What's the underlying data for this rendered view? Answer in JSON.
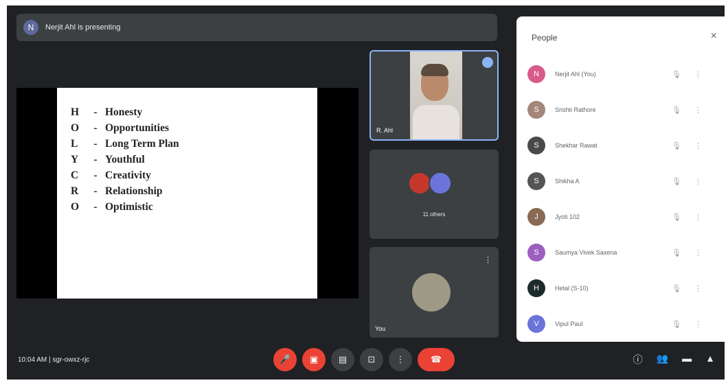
{
  "banner": {
    "presenter_text": "Nerjit Ahl is presenting",
    "avatar_letter": "N"
  },
  "slide": {
    "rows": [
      {
        "letter": "H",
        "dash": "-",
        "word": "Honesty"
      },
      {
        "letter": "O",
        "dash": "-",
        "word": "Opportunities"
      },
      {
        "letter": "L",
        "dash": "-",
        "word": "Long Term Plan"
      },
      {
        "letter": "Y",
        "dash": "-",
        "word": "Youthful"
      },
      {
        "letter": "C",
        "dash": "-",
        "word": "Creativity"
      },
      {
        "letter": "R",
        "dash": "-",
        "word": "Relationship"
      },
      {
        "letter": "O",
        "dash": "-",
        "word": "Optimistic"
      }
    ]
  },
  "tiles": {
    "tile1_name": "R. Ahl",
    "tile2_label": "11 others",
    "tile3_name": "You"
  },
  "bottom": {
    "meeting_info": "10:04 AM  |  sgr-owxz-rjc"
  },
  "people_panel": {
    "title": "People",
    "close": "×",
    "people": [
      {
        "name": "Nerjit Ahl (You)",
        "initial": "N",
        "color": "#d95a8a"
      },
      {
        "name": "Srishti Rathore",
        "initial": "S",
        "color": "#a2877a"
      },
      {
        "name": "Shekhar Rawat",
        "initial": "S",
        "color": "#4a4a4a"
      },
      {
        "name": "Shikha A",
        "initial": "S",
        "color": "#555555"
      },
      {
        "name": "Jyoti 102",
        "initial": "J",
        "color": "#8a6a54"
      },
      {
        "name": "Saumya Vivek Saxena",
        "initial": "S",
        "color": "#9c5fbf"
      },
      {
        "name": "Hetal (S-10)",
        "initial": "H",
        "color": "#1d2b2b"
      },
      {
        "name": "Vipul Paul",
        "initial": "V",
        "color": "#6b74d8"
      }
    ]
  }
}
